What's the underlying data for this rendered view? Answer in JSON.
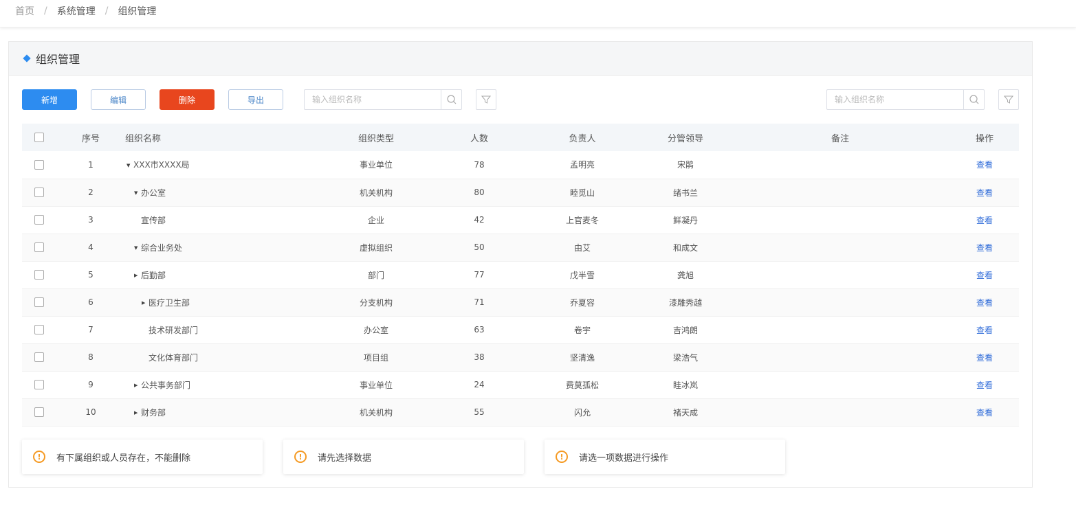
{
  "breadcrumb": [
    "首页",
    "系统管理",
    "组织管理"
  ],
  "breadcrumb_separator": "/",
  "panel": {
    "title": "组织管理"
  },
  "toolbar": {
    "add": "新增",
    "edit": "编辑",
    "delete": "删除",
    "export": "导出"
  },
  "search_left": {
    "placeholder": "输入组织名称",
    "icon": "search-icon",
    "filter_icon": "filter-icon"
  },
  "search_right": {
    "placeholder": "输入组织名称",
    "icon": "search-icon",
    "filter_icon": "filter-icon"
  },
  "table": {
    "columns": [
      "序号",
      "组织名称",
      "组织类型",
      "人数",
      "负责人",
      "分管领导",
      "备注",
      "操作"
    ],
    "rows": [
      {
        "no": "1",
        "name": "XXX市XXXX局",
        "level": 0,
        "toggle": "expanded",
        "type": "事业单位",
        "count": "78",
        "leader": "孟明亮",
        "supervisor": "宋鹃",
        "note": "",
        "action": "查看"
      },
      {
        "no": "2",
        "name": "办公室",
        "level": 1,
        "toggle": "expanded",
        "type": "机关机构",
        "count": "80",
        "leader": "睦觅山",
        "supervisor": "绪书兰",
        "note": "",
        "action": "查看"
      },
      {
        "no": "3",
        "name": "宣传部",
        "level": 1,
        "toggle": "none",
        "type": "企业",
        "count": "42",
        "leader": "上官麦冬",
        "supervisor": "鲜凝丹",
        "note": "",
        "action": "查看"
      },
      {
        "no": "4",
        "name": "综合业务处",
        "level": 1,
        "toggle": "expanded",
        "type": "虚拟组织",
        "count": "50",
        "leader": "由艾",
        "supervisor": "和成文",
        "note": "",
        "action": "查看"
      },
      {
        "no": "5",
        "name": "后勤部",
        "level": 1,
        "toggle": "collapsed",
        "type": "部门",
        "count": "77",
        "leader": "戊半雪",
        "supervisor": "龚旭",
        "note": "",
        "action": "查看"
      },
      {
        "no": "6",
        "name": "医疗卫生部",
        "level": 2,
        "toggle": "collapsed",
        "type": "分支机构",
        "count": "71",
        "leader": "乔夏容",
        "supervisor": "漆雕秀越",
        "note": "",
        "action": "查看"
      },
      {
        "no": "7",
        "name": "技术研发部门",
        "level": 2,
        "toggle": "none",
        "type": "办公室",
        "count": "63",
        "leader": "卷宇",
        "supervisor": "吉鸿朗",
        "note": "",
        "action": "查看"
      },
      {
        "no": "8",
        "name": "文化体育部门",
        "level": 2,
        "toggle": "none",
        "type": "项目组",
        "count": "38",
        "leader": "坚清逸",
        "supervisor": "梁浩气",
        "note": "",
        "action": "查看"
      },
      {
        "no": "9",
        "name": "公共事务部门",
        "level": 1,
        "toggle": "collapsed",
        "type": "事业单位",
        "count": "24",
        "leader": "费莫孤松",
        "supervisor": "眭冰岚",
        "note": "",
        "action": "查看"
      },
      {
        "no": "10",
        "name": "财务部",
        "level": 1,
        "toggle": "collapsed",
        "type": "机关机构",
        "count": "55",
        "leader": "闪允",
        "supervisor": "褚天成",
        "note": "",
        "action": "查看"
      }
    ]
  },
  "alerts": [
    {
      "icon": "warning-icon",
      "text": "有下属组织或人员存在，不能删除"
    },
    {
      "icon": "warning-icon",
      "text": "请先选择数据"
    },
    {
      "icon": "warning-icon",
      "text": "请选一项数据进行操作"
    }
  ],
  "colors": {
    "primary": "#2d8cf0",
    "danger": "#e8461e",
    "warning": "#f59a23",
    "link": "#2d6ad8"
  }
}
